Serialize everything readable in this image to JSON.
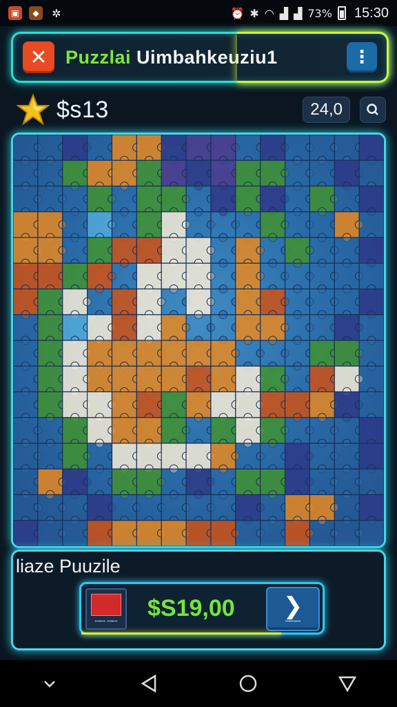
{
  "status_bar": {
    "notifications": [
      "photo-icon",
      "fox-app-icon",
      "settings-icon"
    ],
    "battery_text": "73%",
    "time": "15:30"
  },
  "header": {
    "title_part1": "Puzzlai",
    "title_part2": "Uimbahkeuziu1",
    "close_icon": "close-icon",
    "menu_icon": "more-vert-icon"
  },
  "currency": {
    "icon": "star-icon",
    "amount": "$s13",
    "counter": "24,0",
    "search_icon": "search-icon"
  },
  "board": {
    "colors": {
      "blue": "#2a6ca8",
      "light_blue": "#4fa6d6",
      "navy": "#2e3d8a",
      "purple": "#4b3f8f",
      "green": "#3f8f3a",
      "orange": "#d9872a",
      "dark_orange": "#c3541f",
      "cream": "#e8e3d4",
      "teal": "#2a7d8c"
    }
  },
  "bottom_panel": {
    "title": "liaze Puuzile",
    "piece_label": "ꟷꟷ ꟷꟷ",
    "price": "$S19,00",
    "next_label": "ꟷꟷꟷ",
    "next_icon": "chevron-right-icon"
  },
  "nav_bar": {
    "items": [
      "chevron-down-icon",
      "back-icon",
      "home-icon",
      "recents-icon"
    ]
  }
}
